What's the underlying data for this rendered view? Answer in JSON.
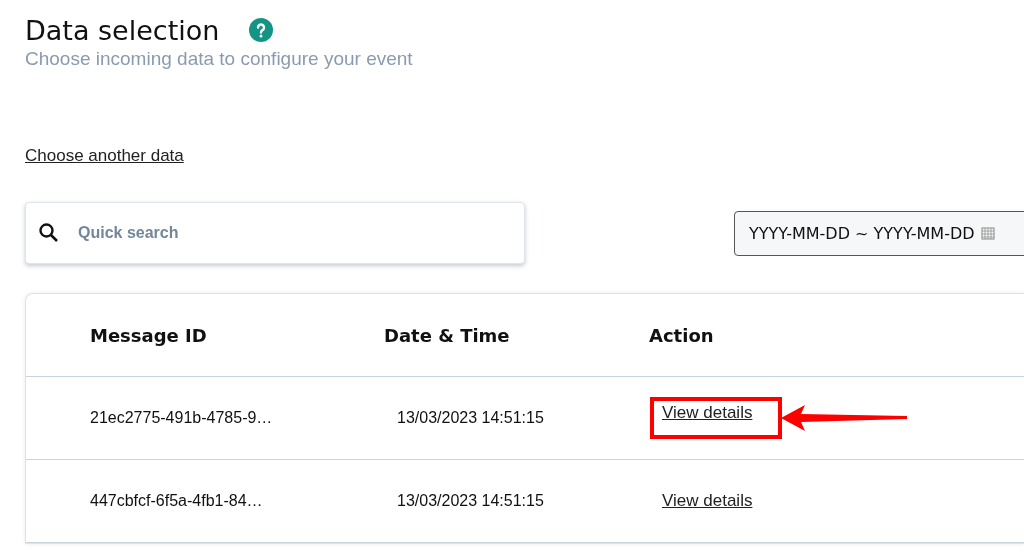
{
  "header": {
    "title": "Data selection",
    "subtitle": "Choose incoming data to configure your event"
  },
  "choose_link": "Choose another data",
  "search": {
    "placeholder": "Quick search"
  },
  "date_range": {
    "value": "YYYY-MM-DD ~ YYYY-MM-DD"
  },
  "table": {
    "columns": [
      "Message ID",
      "Date & Time",
      "Action"
    ],
    "rows": [
      {
        "message_id": "21ec2775-491b-4785-9…",
        "date_time": "13/03/2023 14:51:15",
        "action": "View details",
        "highlighted": true
      },
      {
        "message_id": "447cbfcf-6f5a-4fb1-84…",
        "date_time": "13/03/2023 14:51:15",
        "action": "View details",
        "highlighted": false
      }
    ]
  }
}
